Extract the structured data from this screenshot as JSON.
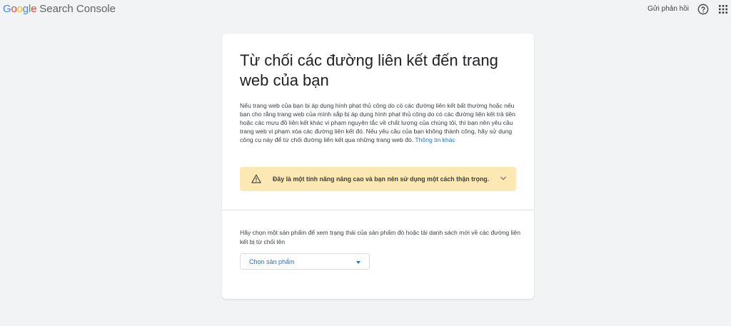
{
  "header": {
    "logo_letters": [
      "G",
      "o",
      "o",
      "g",
      "l",
      "e"
    ],
    "product_name": "Search Console",
    "feedback_label": "Gửi phản hồi"
  },
  "brand_colors": {
    "blue": "#4285F4",
    "red": "#EA4335",
    "yellow": "#FBBC05",
    "green": "#34A853",
    "link": "#1a73e8",
    "warning_bg": "#fce8b2"
  },
  "icons": {
    "help": "help-circle-icon",
    "apps": "apps-grid-icon",
    "warning": "warning-triangle-icon",
    "chevron": "chevron-down-icon",
    "dropdown": "caret-down-icon"
  },
  "card": {
    "title": "Từ chối các đường liên kết đến trang web của bạn",
    "description": "Nếu trang web của bạn bị áp dụng hình phạt thủ công do có các đường liên kết bất thường hoặc nếu bạn cho rằng trang web của mình sắp bị áp dụng hình phạt thủ công do có các đường liên kết trả tiền hoặc các mưu đồ liên kết khác vi phạm nguyên tắc về chất lượng của chúng tôi, thì bạn nên yêu cầu trang web vi phạm xóa các đường liên kết đó. Nếu yêu cầu của bạn không thành công, hãy sử dụng công cụ này để từ chối đường liên kết qua những trang web đó.",
    "learn_more": "Thông tin khác",
    "warning_text": "Đây là một tính năng nâng cao và bạn nên sử dụng một cách thận trọng.",
    "prompt": "Hãy chọn một sản phẩm để xem trạng thái của sản phẩm đó hoặc tải danh sách mới về các đường liên kết bị từ chối lên",
    "select_label": "Chọn sản phẩm"
  }
}
